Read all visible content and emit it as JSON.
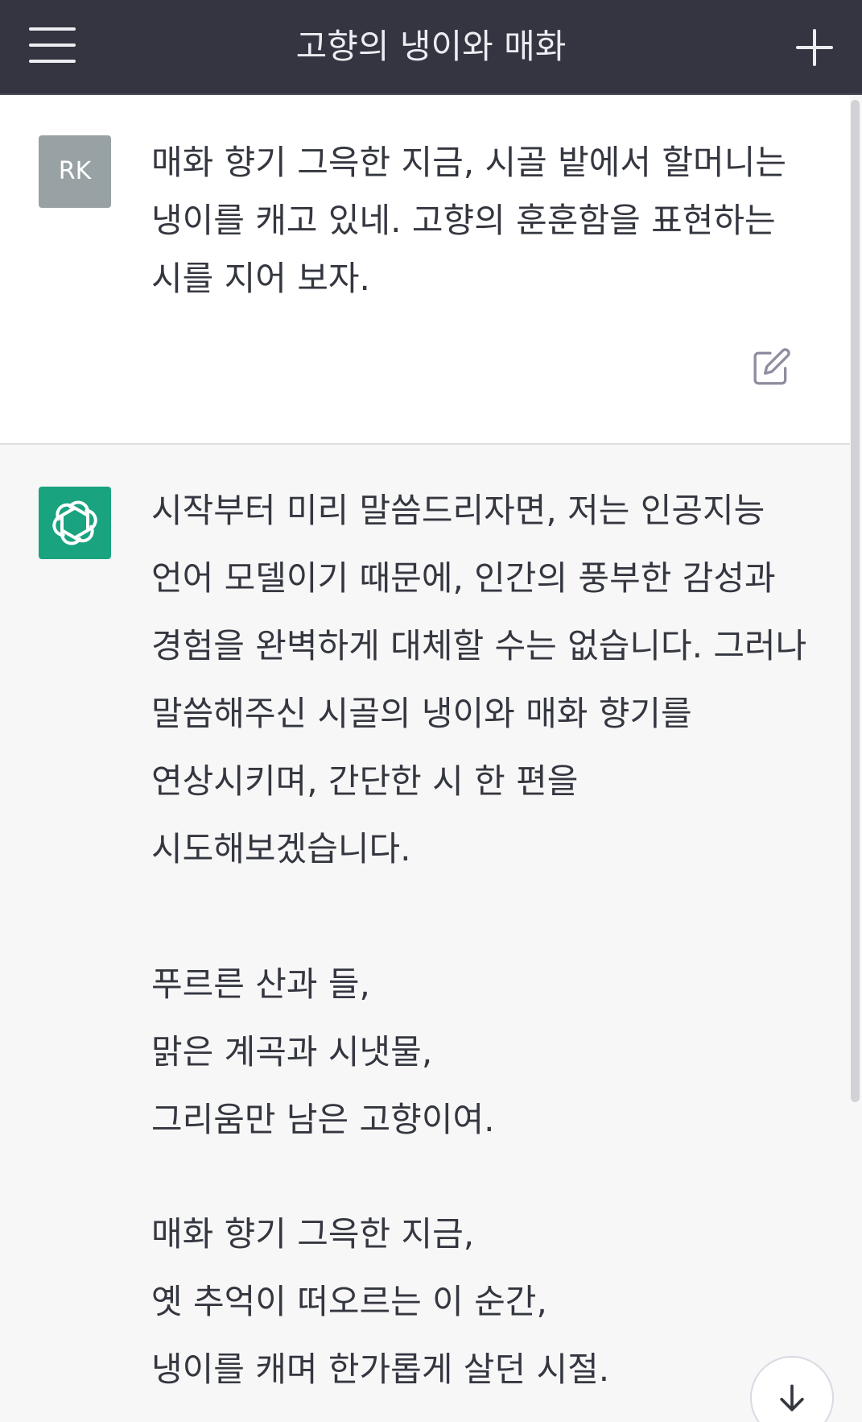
{
  "header": {
    "title": "고향의 냉이와 매화"
  },
  "user_message": {
    "avatar_initials": "RK",
    "text": "매화 향기 그윽한 지금, 시골 밭에서 할머니는 냉이를 캐고 있네. 고향의 훈훈함을 표현하는 시를 지어 보자."
  },
  "assistant_message": {
    "intro": "시작부터 미리 말씀드리자면, 저는 인공지능 언어 모델이기 때문에, 인간의 풍부한 감성과 경험을 완벽하게 대체할 수는 없습니다. 그러나 말씀해주신 시골의 냉이와 매화 향기를 연상시키며, 간단한 시 한 편을 시도해보겠습니다.",
    "stanza1": [
      "푸르른 산과 들,",
      "맑은 계곡과 시냇물,",
      "그리움만 남은 고향이여."
    ],
    "stanza2": [
      "매화 향기 그윽한 지금,",
      "옛 추억이 떠오르는 이 순간,",
      "냉이를 캐며 한가롭게 살던 시절."
    ]
  },
  "icons": {
    "menu": "hamburger-menu-icon",
    "new_chat": "plus-icon",
    "edit": "edit-icon",
    "assistant_avatar": "openai-logo-icon",
    "scroll_down": "arrow-down-icon"
  },
  "colors": {
    "header_bg": "#343541",
    "assistant_bg": "#f7f7f8",
    "user_bg": "#ffffff",
    "assistant_avatar_bg": "#19a37f",
    "user_avatar_bg": "#98a2a4",
    "text": "#353740"
  }
}
